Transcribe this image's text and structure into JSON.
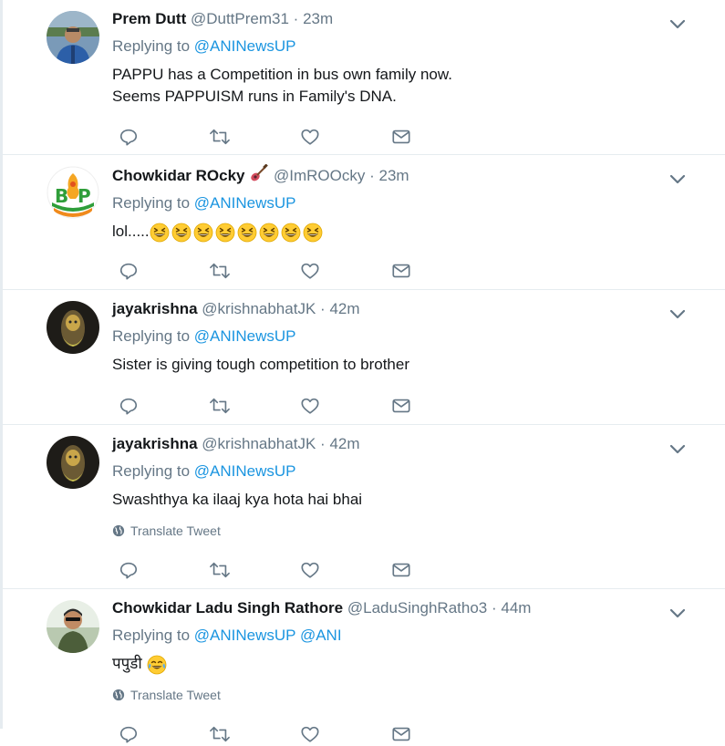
{
  "tweets": [
    {
      "display_name": "Prem Dutt",
      "name_emoji": "",
      "handle": "@DuttPrem31",
      "separator": "·",
      "time": "23m",
      "replying_prefix": "Replying to",
      "mentions": [
        "@ANINewsUP"
      ],
      "text": "PAPPU has a Competition in bus own family now.\nSeems PAPPUISM runs in Family's DNA.",
      "translate": ""
    },
    {
      "display_name": "Chowkidar ROcky",
      "name_emoji": "guitar-emoji",
      "handle": "@ImROOcky",
      "separator": "·",
      "time": "23m",
      "replying_prefix": "Replying to",
      "mentions": [
        "@ANINewsUP"
      ],
      "text": "lol.....",
      "text_emoji_count": 8,
      "text_emoji": "grinning-squinting-face",
      "translate": ""
    },
    {
      "display_name": "jayakrishna",
      "name_emoji": "",
      "handle": "@krishnabhatJK",
      "separator": "·",
      "time": "42m",
      "replying_prefix": "Replying to",
      "mentions": [
        "@ANINewsUP"
      ],
      "text": "Sister is giving tough competition to brother",
      "translate": ""
    },
    {
      "display_name": "jayakrishna",
      "name_emoji": "",
      "handle": "@krishnabhatJK",
      "separator": "·",
      "time": "42m",
      "replying_prefix": "Replying to",
      "mentions": [
        "@ANINewsUP"
      ],
      "text": "Swashthya ka ilaaj kya hota hai bhai",
      "translate": "Translate Tweet"
    },
    {
      "display_name": "Chowkidar Ladu Singh Rathore",
      "name_emoji": "",
      "handle": "@LaduSinghRatho3",
      "separator": "·",
      "time": "44m",
      "replying_prefix": "Replying to",
      "mentions": [
        "@ANINewsUP",
        "@ANI"
      ],
      "text": "पपुडी",
      "text_emoji": "face-with-tears-of-joy",
      "translate": "Translate Tweet"
    }
  ],
  "colors": {
    "text": "#14171a",
    "secondary": "#657786",
    "link": "#1b95e0",
    "divider": "#e6ecf0"
  },
  "icons": {
    "reply": "reply-icon",
    "retweet": "retweet-icon",
    "like": "like-icon",
    "dm": "direct-message-icon",
    "menu": "chevron-down-icon",
    "globe": "globe-icon"
  }
}
